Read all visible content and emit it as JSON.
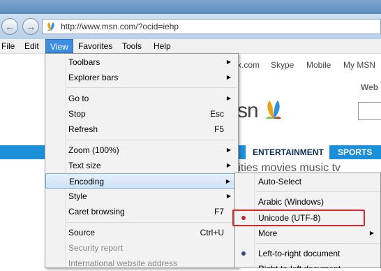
{
  "browser": {
    "address": "http://www.msn.com/?ocid=iehp"
  },
  "menubar": {
    "file": "File",
    "edit": "Edit",
    "view": "View",
    "favorites": "Favorites",
    "tools": "Tools",
    "help": "Help"
  },
  "page": {
    "nav_links": [
      "x.com",
      "Skype",
      "Mobile",
      "My MSN"
    ],
    "web_label": "Web",
    "logo_text": "sn",
    "tab_entertainment": "ENTERTAINMENT",
    "tab_sports": "SPORTS",
    "categories": "rities  movies  music  tv"
  },
  "view_menu": {
    "items": [
      {
        "label": "Toolbars",
        "submenu": true
      },
      {
        "label": "Explorer bars",
        "submenu": true
      },
      {
        "label": "Go to",
        "submenu": true
      },
      {
        "label": "Stop",
        "shortcut": "Esc"
      },
      {
        "label": "Refresh",
        "shortcut": "F5"
      },
      {
        "label": "Zoom (100%)",
        "submenu": true
      },
      {
        "label": "Text size",
        "submenu": true
      },
      {
        "label": "Encoding",
        "submenu": true,
        "highlighted": true
      },
      {
        "label": "Style",
        "submenu": true
      },
      {
        "label": "Caret browsing",
        "shortcut": "F7"
      },
      {
        "label": "Source",
        "shortcut": "Ctrl+U"
      },
      {
        "label": "Security report",
        "disabled": true
      },
      {
        "label": "International website address",
        "disabled": true
      }
    ]
  },
  "encoding_menu": {
    "items": [
      {
        "label": "Auto-Select"
      },
      {
        "label": "Arabic (Windows)"
      },
      {
        "label": "Unicode (UTF-8)",
        "selected": true
      },
      {
        "label": "More",
        "submenu": true
      },
      {
        "label": "Left-to-right document",
        "selected": true
      },
      {
        "label": "Right-to-left document"
      }
    ]
  },
  "colors": {
    "accent": "#3d8ee0",
    "highlight_outline": "#d8262d",
    "msn_bar": "#1c8fdb"
  }
}
